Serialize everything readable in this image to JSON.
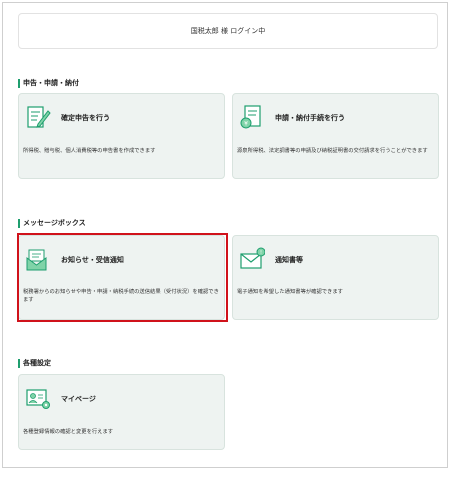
{
  "header": {
    "login_status": "国税太郎 様 ログイン中"
  },
  "sections": {
    "filing": {
      "title": "申告・申請・納付",
      "cards": [
        {
          "title": "確定申告を行う",
          "description": "所得税、贈与税、個人消費税等の申告書を作成できます",
          "icon": "document-pen-icon"
        },
        {
          "title": "申請・納付手続を行う",
          "description": "源泉所得税、法定調書等の申請及び納税証明書の交付請求を行うことができます",
          "icon": "document-yen-icon"
        }
      ]
    },
    "messages": {
      "title": "メッセージボックス",
      "cards": [
        {
          "title": "お知らせ・受信通知",
          "description": "税務署からのお知らせや申告・申請・納税手続の送信結果（受付状況）を確認できます",
          "icon": "mail-open-icon"
        },
        {
          "title": "通知書等",
          "description": "電子通知を希望した通知書等が確認できます",
          "icon": "mail-notice-icon"
        }
      ]
    },
    "settings": {
      "title": "各種設定",
      "cards": [
        {
          "title": "マイページ",
          "description": "各種登録情報の確認と変更を行えます",
          "icon": "profile-gear-icon"
        }
      ]
    }
  },
  "colors": {
    "accent": "#1e9e6e",
    "card_bg": "#eef3f1",
    "highlight": "#d0121b"
  }
}
